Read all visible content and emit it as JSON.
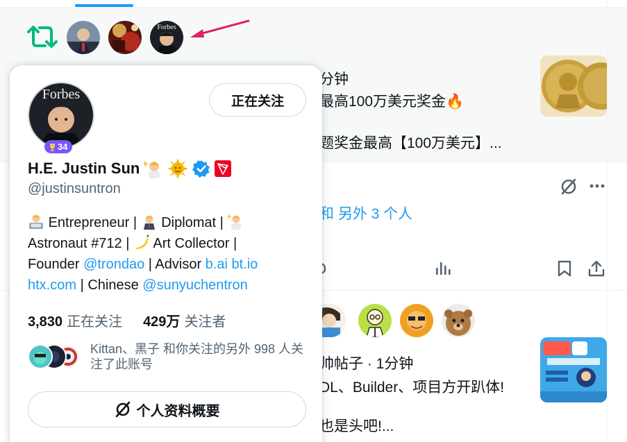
{
  "feed": {
    "post1": {
      "time": "分钟",
      "line1": "最高100万美元奖金🔥",
      "line2": "题奖金最高【100万美元】..."
    },
    "post2": {
      "liked_by": "和 另外 3 个人"
    },
    "post3": {
      "author_time": "帅帖子 · 1分钟",
      "line1": "DL、Builder、项目方开趴体!",
      "line2": "也是头吧!..."
    }
  },
  "hover_card": {
    "name": "H.E. Justin Sun",
    "handle": "@justinsuntron",
    "badge_count": "34",
    "follow_button": "正在关注",
    "bio": {
      "entrepreneur": "Entrepreneur |",
      "diplomat": "Diplomat |",
      "astronaut": "Astronaut #712 |",
      "art": "Art Collector |",
      "founder": "Founder",
      "trondao": "@trondao",
      "advisor": "| Advisor",
      "bai": "b.ai",
      "btio": "bt.io",
      "htx": "htx.com",
      "chinese": "| Chinese",
      "sunyuchentron": "@sunyuchentron"
    },
    "following_count": "3,830",
    "following_label": "正在关注",
    "followers_count": "429万",
    "followers_label": "关注者",
    "followed_by": "Kittan、黑子 和你关注的另外 998 人关注了此账号",
    "profile_button": "个人资料概要"
  },
  "colors": {
    "accent": "#1d9bf0",
    "retweet": "#00ba7c",
    "badge": "#7856ff",
    "arrow": "#e0245e"
  }
}
